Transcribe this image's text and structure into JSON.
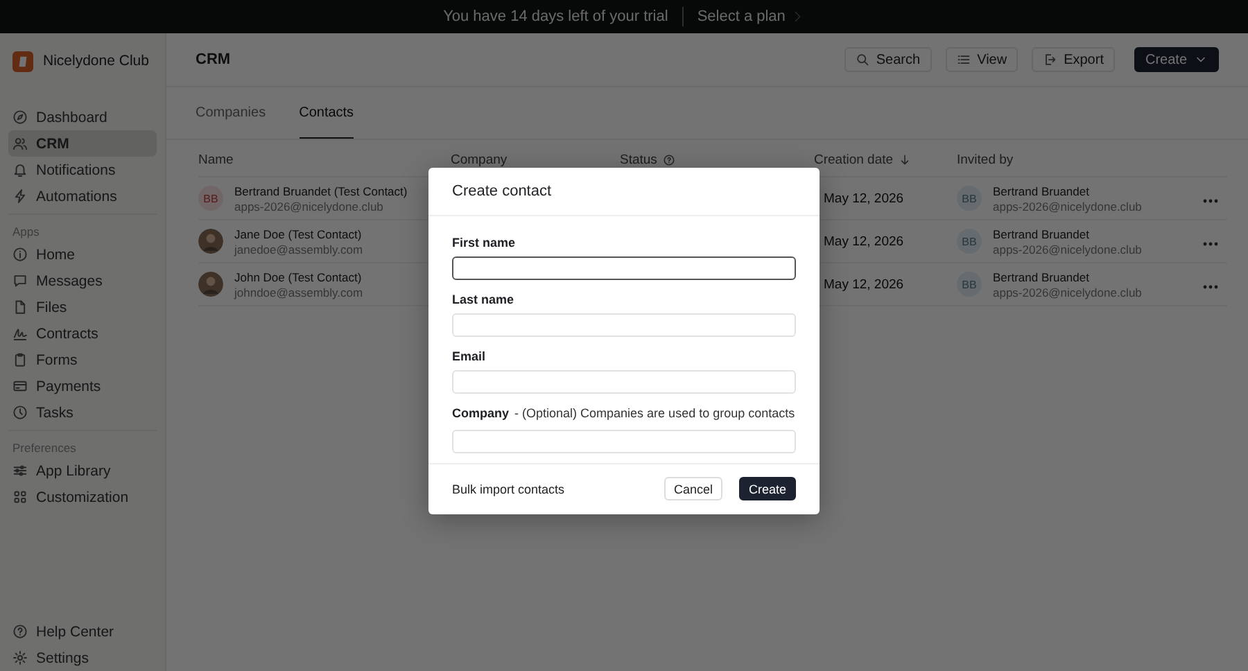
{
  "banner": {
    "message": "You have 14 days left of your trial",
    "link": "Select a plan"
  },
  "sidebar": {
    "workspace": "Nicelydone Club",
    "sections": [
      {
        "items": [
          {
            "label": "Dashboard",
            "selected": false
          },
          {
            "label": "CRM",
            "selected": true
          },
          {
            "label": "Notifications",
            "selected": false
          },
          {
            "label": "Automations",
            "selected": false
          }
        ]
      },
      {
        "heading": "Apps",
        "items": [
          {
            "label": "Home",
            "selected": false
          },
          {
            "label": "Messages",
            "selected": false
          },
          {
            "label": "Files",
            "selected": false
          },
          {
            "label": "Contracts",
            "selected": false
          },
          {
            "label": "Forms",
            "selected": false
          },
          {
            "label": "Payments",
            "selected": false
          },
          {
            "label": "Tasks",
            "selected": false
          }
        ]
      },
      {
        "heading": "Preferences",
        "items": [
          {
            "label": "App Library",
            "selected": false
          },
          {
            "label": "Customization",
            "selected": false
          }
        ]
      }
    ],
    "footer": [
      {
        "label": "Help Center",
        "selected": false
      },
      {
        "label": "Settings",
        "selected": false
      }
    ]
  },
  "header": {
    "title": "CRM",
    "actions": [
      {
        "label": "Search",
        "kind": "search"
      },
      {
        "label": "View",
        "kind": "view"
      },
      {
        "label": "Export",
        "kind": "export"
      },
      {
        "label": "Create",
        "kind": "primary"
      }
    ]
  },
  "tabs": [
    {
      "label": "Companies",
      "selected": false
    },
    {
      "label": "Contacts",
      "selected": true
    }
  ],
  "table": {
    "columns": [
      {
        "label": "Name",
        "help": false,
        "sorted": false
      },
      {
        "label": "Company",
        "help": false,
        "sorted": false
      },
      {
        "label": "Status",
        "help": true,
        "sorted": false
      },
      {
        "label": "Creation date",
        "help": false,
        "sorted": true
      },
      {
        "label": "Invited by",
        "help": false,
        "sorted": false
      }
    ],
    "rows": [
      {
        "name": "Bertrand Bruandet (Test Contact)",
        "email": "apps-2026@nicelydone.club",
        "avatar": {
          "kind": "initials",
          "initials": "BB"
        },
        "date": "May 12, 2026",
        "invited_by": {
          "name": "Bertrand Bruandet",
          "email": "apps-2026@nicelydone.club",
          "initials": "BB"
        }
      },
      {
        "name": "Jane Doe (Test Contact)",
        "email": "janedoe@assembly.com",
        "avatar": {
          "kind": "photo"
        },
        "date": "May 12, 2026",
        "invited_by": {
          "name": "Bertrand Bruandet",
          "email": "apps-2026@nicelydone.club",
          "initials": "BB"
        }
      },
      {
        "name": "John Doe (Test Contact)",
        "email": "johndoe@assembly.com",
        "avatar": {
          "kind": "photo"
        },
        "date": "May 12, 2026",
        "invited_by": {
          "name": "Bertrand Bruandet",
          "email": "apps-2026@nicelydone.club",
          "initials": "BB"
        }
      }
    ]
  },
  "modal": {
    "title": "Create contact",
    "fields": [
      {
        "label": "First name",
        "focused": true
      },
      {
        "label": "Last name",
        "focused": false
      },
      {
        "label": "Email",
        "focused": false
      },
      {
        "label": "Company",
        "hint": "- (Optional) Companies are used to group contacts",
        "focused": false
      }
    ],
    "link": "Bulk import contacts",
    "buttons": [
      {
        "label": "Cancel",
        "kind": "secondary"
      },
      {
        "label": "Create",
        "kind": "primary"
      }
    ]
  }
}
